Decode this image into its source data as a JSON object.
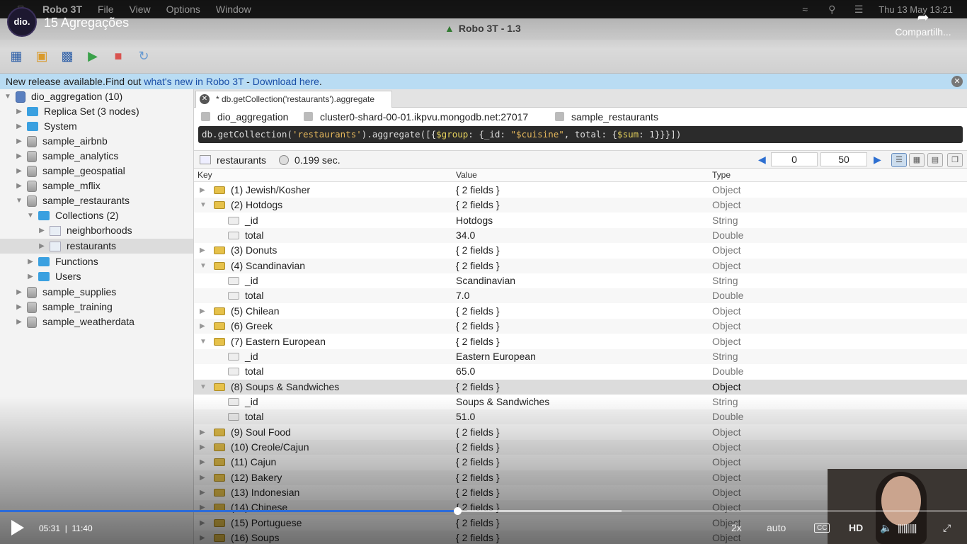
{
  "menubar": {
    "app": "Robo 3T",
    "items": [
      "File",
      "View",
      "Options",
      "Window"
    ],
    "clock": "Thu 13 May  13:21"
  },
  "window": {
    "title": "Robo 3T - 1.3"
  },
  "banner": {
    "text": "New release available.Find out ",
    "link1": "what's new in Robo 3T",
    "sep": " - ",
    "link2": "Download here",
    "end": "."
  },
  "sidebar": {
    "root": "dio_aggregation (10)",
    "items": [
      {
        "label": "Replica Set (3 nodes)"
      },
      {
        "label": "System"
      },
      {
        "label": "sample_airbnb"
      },
      {
        "label": "sample_analytics"
      },
      {
        "label": "sample_geospatial"
      },
      {
        "label": "sample_mflix"
      },
      {
        "label": "sample_restaurants"
      },
      {
        "label": "Collections (2)"
      },
      {
        "label": "neighborhoods"
      },
      {
        "label": "restaurants"
      },
      {
        "label": "Functions"
      },
      {
        "label": "Users"
      },
      {
        "label": "sample_supplies"
      },
      {
        "label": "sample_training"
      },
      {
        "label": "sample_weatherdata"
      }
    ]
  },
  "tab": {
    "label": "* db.getCollection('restaurants').aggregate"
  },
  "connection": {
    "db": "dio_aggregation",
    "server": "cluster0-shard-00-01.ikpvu.mongodb.net:27017",
    "database": "sample_restaurants"
  },
  "query": {
    "p1": "db.getCollection(",
    "s1": "'restaurants'",
    "p2": ").aggregate([{",
    "k1": "$group",
    "p3": ": {_id: ",
    "s2": "\"$cuisine\"",
    "p4": ", total: {",
    "k2": "$sum",
    "p5": ": 1}}}])"
  },
  "results": {
    "collection": "restaurants",
    "time": "0.199 sec.",
    "skip": "0",
    "limit": "50"
  },
  "grid": {
    "headers": {
      "key": "Key",
      "value": "Value",
      "type": "Type"
    },
    "rows": [
      {
        "level": 0,
        "open": false,
        "key": "(1) Jewish/Kosher",
        "value": "{ 2 fields }",
        "type": "Object"
      },
      {
        "level": 0,
        "open": true,
        "key": "(2) Hotdogs",
        "value": "{ 2 fields }",
        "type": "Object"
      },
      {
        "level": 1,
        "key": "_id",
        "value": "Hotdogs",
        "type": "String"
      },
      {
        "level": 1,
        "key": "total",
        "value": "34.0",
        "type": "Double"
      },
      {
        "level": 0,
        "open": false,
        "key": "(3) Donuts",
        "value": "{ 2 fields }",
        "type": "Object"
      },
      {
        "level": 0,
        "open": true,
        "key": "(4) Scandinavian",
        "value": "{ 2 fields }",
        "type": "Object"
      },
      {
        "level": 1,
        "key": "_id",
        "value": "Scandinavian",
        "type": "String"
      },
      {
        "level": 1,
        "key": "total",
        "value": "7.0",
        "type": "Double"
      },
      {
        "level": 0,
        "open": false,
        "key": "(5) Chilean",
        "value": "{ 2 fields }",
        "type": "Object"
      },
      {
        "level": 0,
        "open": false,
        "key": "(6) Greek",
        "value": "{ 2 fields }",
        "type": "Object"
      },
      {
        "level": 0,
        "open": true,
        "key": "(7) Eastern European",
        "value": "{ 2 fields }",
        "type": "Object"
      },
      {
        "level": 1,
        "key": "_id",
        "value": "Eastern European",
        "type": "String"
      },
      {
        "level": 1,
        "key": "total",
        "value": "65.0",
        "type": "Double"
      },
      {
        "level": 0,
        "open": true,
        "key": "(8) Soups & Sandwiches",
        "value": "{ 2 fields }",
        "type": "Object",
        "selected": true
      },
      {
        "level": 1,
        "key": "_id",
        "value": "Soups & Sandwiches",
        "type": "String"
      },
      {
        "level": 1,
        "key": "total",
        "value": "51.0",
        "type": "Double"
      },
      {
        "level": 0,
        "open": false,
        "key": "(9) Soul Food",
        "value": "{ 2 fields }",
        "type": "Object"
      },
      {
        "level": 0,
        "open": false,
        "key": "(10) Creole/Cajun",
        "value": "{ 2 fields }",
        "type": "Object"
      },
      {
        "level": 0,
        "open": false,
        "key": "(11) Cajun",
        "value": "{ 2 fields }",
        "type": "Object"
      },
      {
        "level": 0,
        "open": false,
        "key": "(12) Bakery",
        "value": "{ 2 fields }",
        "type": "Object"
      },
      {
        "level": 0,
        "open": false,
        "key": "(13) Indonesian",
        "value": "{ 2 fields }",
        "type": "Object"
      },
      {
        "level": 0,
        "open": false,
        "key": "(14) Chinese",
        "value": "{ 2 fields }",
        "type": "Object"
      },
      {
        "level": 0,
        "open": false,
        "key": "(15) Portuguese",
        "value": "{ 2 fields }",
        "type": "Object"
      },
      {
        "level": 0,
        "open": false,
        "key": "(16) Soups",
        "value": "{ 2 fields }",
        "type": "Object"
      }
    ]
  },
  "video": {
    "title": "15 Agregações",
    "channel": "dio.",
    "share": "Compartilh...",
    "current": "05:31",
    "sep": "|",
    "duration": "11:40",
    "progress": 0.473,
    "speed": "2x",
    "quality": "auto",
    "cc": "CC",
    "hd": "HD"
  }
}
